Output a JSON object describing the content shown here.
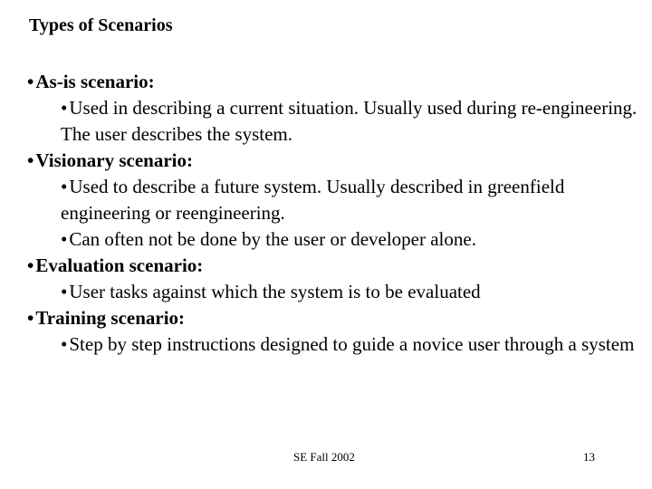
{
  "slide": {
    "title": "Types of Scenarios",
    "bullet": "•",
    "items": [
      {
        "heading": "As-is scenario:",
        "subitems": [
          "Used in describing a current situation. Usually used during re-engineering. The user describes the system."
        ]
      },
      {
        "heading": "Visionary scenario:",
        "subitems": [
          "Used to describe a future system. Usually described in greenfield engineering or reengineering.",
          "Can often not be done by the user or developer alone."
        ]
      },
      {
        "heading": "Evaluation scenario:",
        "subitems": [
          "User tasks against which the system is to be evaluated"
        ]
      },
      {
        "heading": "Training scenario:",
        "subitems": [
          "Step by step instructions designed to guide a novice user through a system"
        ]
      }
    ],
    "footer": {
      "course": "SE Fall 2002",
      "page_number": "13"
    }
  }
}
